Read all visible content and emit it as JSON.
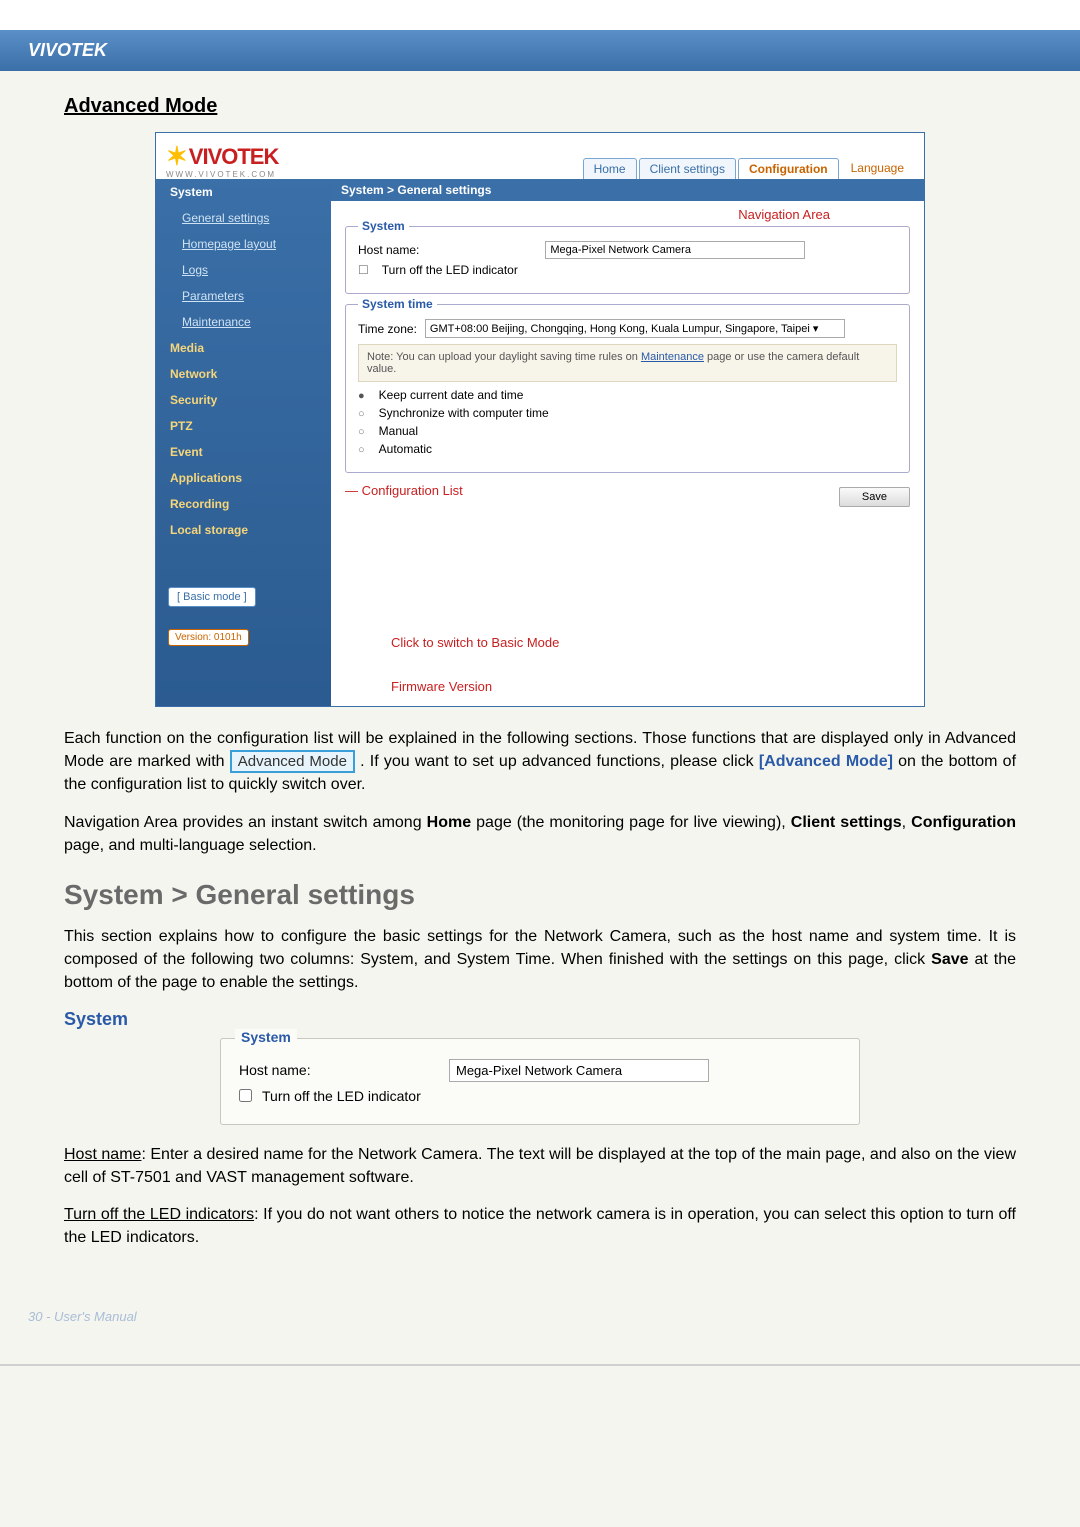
{
  "header": {
    "brand": "VIVOTEK"
  },
  "page": {
    "section_title": "Advanced Mode",
    "h2": "System > General settings",
    "subhead": "System",
    "footer": "30 - User's Manual"
  },
  "screenshot": {
    "logo_text": "VIVOTEK",
    "logo_url": "WWW.VIVOTEK.COM",
    "nav": {
      "home": "Home",
      "client": "Client settings",
      "config": "Configuration",
      "language": "Language"
    },
    "breadcrumb": "System  >  General settings",
    "sidebar": {
      "system": "System",
      "general": "General settings",
      "homepage": "Homepage layout",
      "logs": "Logs",
      "params": "Parameters",
      "maint": "Maintenance",
      "media": "Media",
      "network": "Network",
      "security": "Security",
      "ptz": "PTZ",
      "event": "Event",
      "applications": "Applications",
      "recording": "Recording",
      "storage": "Local storage"
    },
    "system_group": {
      "legend": "System",
      "host_label": "Host name:",
      "host_value": "Mega-Pixel Network Camera",
      "led_label": "Turn off the LED indicator"
    },
    "time_group": {
      "legend": "System time",
      "tz_label": "Time zone:",
      "tz_value": "GMT+08:00 Beijing, Chongqing, Hong Kong, Kuala Lumpur, Singapore, Taipei",
      "note_pre": "Note: You can upload your daylight saving time rules on ",
      "note_link": "Maintenance",
      "note_post": " page or use the camera default value.",
      "opt_keep": "Keep current date and time",
      "opt_sync": "Synchronize with computer time",
      "opt_manual": "Manual",
      "opt_auto": "Automatic"
    },
    "save_btn": "Save",
    "basic_mode": "[ Basic mode ]",
    "version": "Version: 0101h",
    "annotations": {
      "nav_area": "Navigation Area",
      "config_list": "Configuration List",
      "basic_switch": "Click to switch to Basic Mode",
      "fw_version": "Firmware Version"
    }
  },
  "paragraphs": {
    "p1a": "Each function on the configuration list will be explained in the following sections. Those functions that are displayed only in Advanced Mode are marked with ",
    "p1_badge": "Advanced Mode",
    "p1b": ". If you want to set up advanced functions, please click ",
    "p1_link": "[Advanced Mode]",
    "p1c": " on the bottom of the configuration list to quickly switch over.",
    "p2a": "Navigation Area provides an instant switch among ",
    "p2_home": "Home",
    "p2b": " page (the monitoring page for live viewing), ",
    "p2_client": "Client settings",
    "p2c": ", ",
    "p2_config": "Configuration",
    "p2d": " page, and multi-language selection.",
    "p3": "This section explains how to configure the basic settings for the Network Camera, such as the host name and system time. It is composed of the following two columns: System, and System Time. When finished with the settings on this page, click ",
    "p3_save": "Save",
    "p3b": " at the bottom of the page to enable the settings.",
    "hostname_label": "Host name",
    "p4": ": Enter a desired name for the Network Camera. The text will be displayed at the top of the main page, and also on the view cell of ST-7501 and VAST management software.",
    "led_label": "Turn off the LED indicators",
    "p5": ": If you do not want others to notice the network camera is in operation, you can select this option to turn off the LED indicators."
  },
  "system_box": {
    "legend": "System",
    "host_label": "Host name:",
    "host_value": "Mega-Pixel Network Camera",
    "led_label": "Turn off the LED indicator"
  }
}
